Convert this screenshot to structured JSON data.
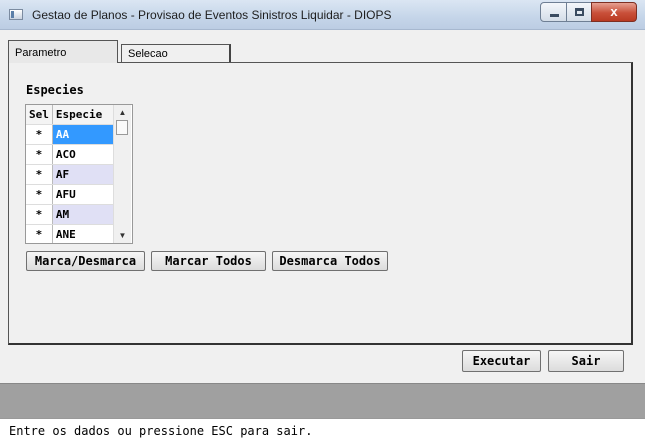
{
  "window": {
    "title": "Gestao de Planos - Provisao de Eventos Sinistros Liquidar - DIOPS",
    "close_glyph": "x"
  },
  "tabs": [
    {
      "label": "Parametro"
    },
    {
      "label": "Selecao"
    }
  ],
  "especies": {
    "label": "Especies",
    "columns": [
      "Sel",
      "Especie"
    ],
    "rows": [
      {
        "sel": "*",
        "especie": "AA"
      },
      {
        "sel": "*",
        "especie": "ACO"
      },
      {
        "sel": "*",
        "especie": "AF"
      },
      {
        "sel": "*",
        "especie": "AFU"
      },
      {
        "sel": "*",
        "especie": "AM"
      },
      {
        "sel": "*",
        "especie": "ANE"
      }
    ],
    "scroll_up": "▲",
    "scroll_down": "▼"
  },
  "buttons": {
    "marca_desmarca": "Marca/Desmarca",
    "marcar_todos": "Marcar Todos",
    "desmarca_todos": "Desmarca Todos",
    "executar": "Executar",
    "sair": "Sair"
  },
  "status": {
    "text": "Entre os dados ou pressione ESC para sair."
  }
}
